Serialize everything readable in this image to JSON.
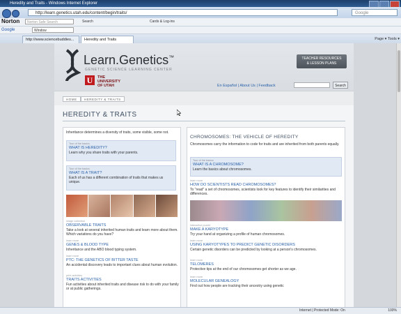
{
  "window": {
    "title": "Heredity and Traits - Windows Internet Explorer"
  },
  "browser": {
    "url": "http://learn.genetics.utah.edu/content/begin/traits/",
    "search_placeholder": "Google",
    "norton": {
      "label": "Norton",
      "search_placeholder": "Norton Safe Search",
      "search_button": "Search",
      "identity_label": "Cards & Log-ins"
    },
    "google": {
      "label": "Google",
      "input_value": "Window"
    },
    "tabs": [
      {
        "label": "http://www.sciencebuddies..."
      },
      {
        "label": "Heredity and Traits"
      }
    ],
    "tools_text": "Page ▾  Tools ▾",
    "status_zone": "Internet | Protected Mode: On",
    "status_zoom": "100%"
  },
  "site": {
    "logo_title": "Learn.Genetics",
    "logo_tm": "™",
    "logo_subtitle": "GENETIC SCIENCE LEARNING CENTER",
    "university_mark": "U",
    "university_name": "THE\nUNIVERSITY\nOF UTAH",
    "teacher_button": "TEACHER RESOURCES\n& LESSON PLANS",
    "toplinks": "En Español | About Us | Feedback",
    "search_button": "Search",
    "breadcrumbs": [
      "HOME",
      "HEREDITY & TRAITS"
    ]
  },
  "page": {
    "title": "HEREDITY & TRAITS",
    "left": {
      "intro": "Inheritance determines a diversity of traits, some visible, some not.",
      "features": [
        {
          "kicker": "Tour of the basics",
          "title": "WHAT IS HEREDITY?",
          "desc": "Learn why you share traits with your parents."
        },
        {
          "kicker": "Tour of the basics",
          "title": "WHAT IS A TRAIT?",
          "desc": "Each of us has a different combination of traits that makes us unique."
        }
      ],
      "items": [
        {
          "kicker": "image collection",
          "title": "OBSERVABLE TRAITS",
          "desc": "Take a look at several inherited human traits and learn more about them. Which variations do you have?"
        },
        {
          "kicker": "learn more",
          "title": "GENES & BLOOD TYPE",
          "desc": "Inheritance and the ABO blood typing system."
        },
        {
          "kicker": "learn more",
          "title": "PTC: THE GENETICS OF BITTER TASTE",
          "desc": "An accidental discovery leads to important clues about human evolution."
        },
        {
          "kicker": "print activities",
          "title": "TRAITS ACTIVITIES",
          "desc": "Fun activities about inherited traits and disease risk to do with your family or at public gatherings."
        }
      ]
    },
    "right": {
      "title": "CHROMOSOMES: THE VEHICLE OF HEREDITY",
      "intro": "Chromosomes carry the information to code for traits and are inherited from both parents equally.",
      "feature": {
        "kicker": "Tour of the basics",
        "title": "WHAT IS A CHROMOSOME?",
        "desc": "Learn the basics about chromosomes."
      },
      "items": [
        {
          "kicker": "learn more",
          "title": "HOW DO SCIENTISTS READ CHROMOSOMES?",
          "desc": "To \"read\" a set of chromosomes, scientists look for key features to identify their similarities and differences."
        },
        {
          "kicker": "interactive puzzle",
          "title": "MAKE A KARYOTYPE",
          "desc": "Try your hand at organizing a profile of human chromosomes."
        },
        {
          "kicker": "learn more",
          "title": "USING KARYOTYPES TO PREDICT GENETIC DISORDERS",
          "desc": "Certain genetic disorders can be predicted by looking at a person's chromosomes."
        },
        {
          "kicker": "learn more",
          "title": "TELOMERES",
          "desc": "Protective tips at the end of our chromosomes get shorter as we age."
        },
        {
          "kicker": "learn more",
          "title": "MOLECULAR GENEALOGY",
          "desc": "Find out how people are tracking their ancestry using genetic"
        }
      ]
    }
  },
  "colors": {
    "link_blue": "#2a61a8",
    "utah_red": "#c01a1e",
    "feature_bg": "#e1e9f5"
  }
}
